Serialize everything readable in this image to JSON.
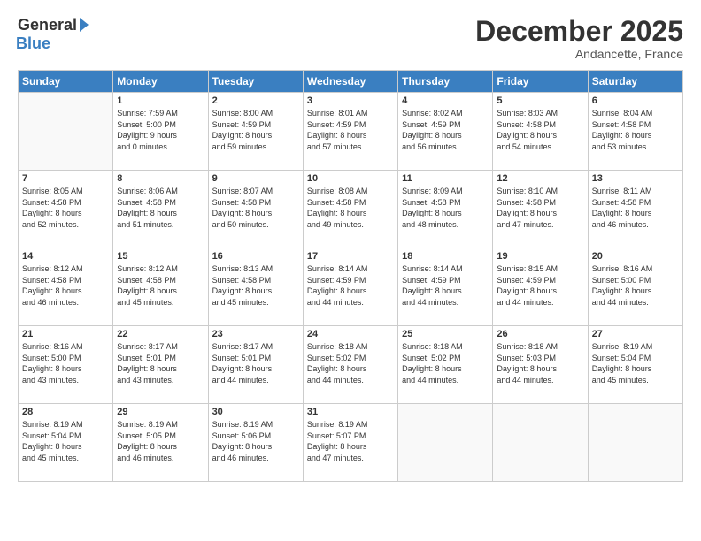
{
  "logo": {
    "general": "General",
    "blue": "Blue"
  },
  "title": "December 2025",
  "location": "Andancette, France",
  "days_header": [
    "Sunday",
    "Monday",
    "Tuesday",
    "Wednesday",
    "Thursday",
    "Friday",
    "Saturday"
  ],
  "weeks": [
    [
      {
        "day": "",
        "info": ""
      },
      {
        "day": "1",
        "info": "Sunrise: 7:59 AM\nSunset: 5:00 PM\nDaylight: 9 hours\nand 0 minutes."
      },
      {
        "day": "2",
        "info": "Sunrise: 8:00 AM\nSunset: 4:59 PM\nDaylight: 8 hours\nand 59 minutes."
      },
      {
        "day": "3",
        "info": "Sunrise: 8:01 AM\nSunset: 4:59 PM\nDaylight: 8 hours\nand 57 minutes."
      },
      {
        "day": "4",
        "info": "Sunrise: 8:02 AM\nSunset: 4:59 PM\nDaylight: 8 hours\nand 56 minutes."
      },
      {
        "day": "5",
        "info": "Sunrise: 8:03 AM\nSunset: 4:58 PM\nDaylight: 8 hours\nand 54 minutes."
      },
      {
        "day": "6",
        "info": "Sunrise: 8:04 AM\nSunset: 4:58 PM\nDaylight: 8 hours\nand 53 minutes."
      }
    ],
    [
      {
        "day": "7",
        "info": "Sunrise: 8:05 AM\nSunset: 4:58 PM\nDaylight: 8 hours\nand 52 minutes."
      },
      {
        "day": "8",
        "info": "Sunrise: 8:06 AM\nSunset: 4:58 PM\nDaylight: 8 hours\nand 51 minutes."
      },
      {
        "day": "9",
        "info": "Sunrise: 8:07 AM\nSunset: 4:58 PM\nDaylight: 8 hours\nand 50 minutes."
      },
      {
        "day": "10",
        "info": "Sunrise: 8:08 AM\nSunset: 4:58 PM\nDaylight: 8 hours\nand 49 minutes."
      },
      {
        "day": "11",
        "info": "Sunrise: 8:09 AM\nSunset: 4:58 PM\nDaylight: 8 hours\nand 48 minutes."
      },
      {
        "day": "12",
        "info": "Sunrise: 8:10 AM\nSunset: 4:58 PM\nDaylight: 8 hours\nand 47 minutes."
      },
      {
        "day": "13",
        "info": "Sunrise: 8:11 AM\nSunset: 4:58 PM\nDaylight: 8 hours\nand 46 minutes."
      }
    ],
    [
      {
        "day": "14",
        "info": "Sunrise: 8:12 AM\nSunset: 4:58 PM\nDaylight: 8 hours\nand 46 minutes."
      },
      {
        "day": "15",
        "info": "Sunrise: 8:12 AM\nSunset: 4:58 PM\nDaylight: 8 hours\nand 45 minutes."
      },
      {
        "day": "16",
        "info": "Sunrise: 8:13 AM\nSunset: 4:58 PM\nDaylight: 8 hours\nand 45 minutes."
      },
      {
        "day": "17",
        "info": "Sunrise: 8:14 AM\nSunset: 4:59 PM\nDaylight: 8 hours\nand 44 minutes."
      },
      {
        "day": "18",
        "info": "Sunrise: 8:14 AM\nSunset: 4:59 PM\nDaylight: 8 hours\nand 44 minutes."
      },
      {
        "day": "19",
        "info": "Sunrise: 8:15 AM\nSunset: 4:59 PM\nDaylight: 8 hours\nand 44 minutes."
      },
      {
        "day": "20",
        "info": "Sunrise: 8:16 AM\nSunset: 5:00 PM\nDaylight: 8 hours\nand 44 minutes."
      }
    ],
    [
      {
        "day": "21",
        "info": "Sunrise: 8:16 AM\nSunset: 5:00 PM\nDaylight: 8 hours\nand 43 minutes."
      },
      {
        "day": "22",
        "info": "Sunrise: 8:17 AM\nSunset: 5:01 PM\nDaylight: 8 hours\nand 43 minutes."
      },
      {
        "day": "23",
        "info": "Sunrise: 8:17 AM\nSunset: 5:01 PM\nDaylight: 8 hours\nand 44 minutes."
      },
      {
        "day": "24",
        "info": "Sunrise: 8:18 AM\nSunset: 5:02 PM\nDaylight: 8 hours\nand 44 minutes."
      },
      {
        "day": "25",
        "info": "Sunrise: 8:18 AM\nSunset: 5:02 PM\nDaylight: 8 hours\nand 44 minutes."
      },
      {
        "day": "26",
        "info": "Sunrise: 8:18 AM\nSunset: 5:03 PM\nDaylight: 8 hours\nand 44 minutes."
      },
      {
        "day": "27",
        "info": "Sunrise: 8:19 AM\nSunset: 5:04 PM\nDaylight: 8 hours\nand 45 minutes."
      }
    ],
    [
      {
        "day": "28",
        "info": "Sunrise: 8:19 AM\nSunset: 5:04 PM\nDaylight: 8 hours\nand 45 minutes."
      },
      {
        "day": "29",
        "info": "Sunrise: 8:19 AM\nSunset: 5:05 PM\nDaylight: 8 hours\nand 46 minutes."
      },
      {
        "day": "30",
        "info": "Sunrise: 8:19 AM\nSunset: 5:06 PM\nDaylight: 8 hours\nand 46 minutes."
      },
      {
        "day": "31",
        "info": "Sunrise: 8:19 AM\nSunset: 5:07 PM\nDaylight: 8 hours\nand 47 minutes."
      },
      {
        "day": "",
        "info": ""
      },
      {
        "day": "",
        "info": ""
      },
      {
        "day": "",
        "info": ""
      }
    ]
  ]
}
